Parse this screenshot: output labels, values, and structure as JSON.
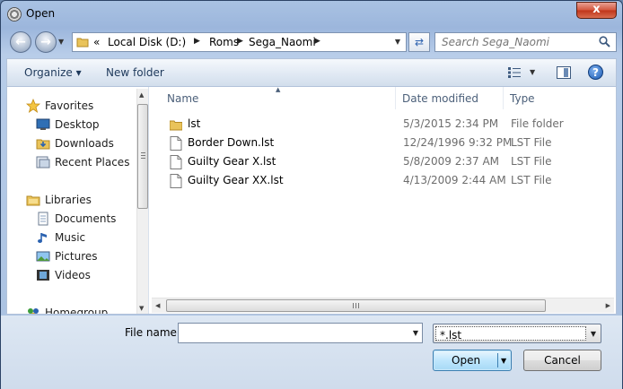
{
  "window": {
    "title": "Open",
    "close_label": "x"
  },
  "nav": {
    "back_label": "←",
    "forward_label": "→",
    "address_prefix": "«",
    "breadcrumb": [
      "Local Disk (D:)",
      "Roms",
      "Sega_Naomi"
    ],
    "refresh_label": "⇄",
    "search_placeholder": "Search Sega_Naomi"
  },
  "toolbar": {
    "organize_label": "Organize ▾",
    "new_folder_label": "New folder",
    "help_label": "?"
  },
  "sidebar": {
    "items": [
      {
        "label": "Favorites",
        "icon": "star-icon"
      },
      {
        "label": "Desktop",
        "icon": "desktop-icon"
      },
      {
        "label": "Downloads",
        "icon": "downloads-icon"
      },
      {
        "label": "Recent Places",
        "icon": "recent-places-icon"
      },
      {
        "label": "Libraries",
        "icon": "libraries-icon"
      },
      {
        "label": "Documents",
        "icon": "documents-icon"
      },
      {
        "label": "Music",
        "icon": "music-icon"
      },
      {
        "label": "Pictures",
        "icon": "pictures-icon"
      },
      {
        "label": "Videos",
        "icon": "videos-icon"
      },
      {
        "label": "Homegroup",
        "icon": "homegroup-icon"
      }
    ]
  },
  "files": {
    "columns": [
      "Name",
      "Date modified",
      "Type"
    ],
    "rows": [
      {
        "name": "lst",
        "date": "5/3/2015 2:34 PM",
        "type": "File folder",
        "icon": "folder-icon"
      },
      {
        "name": "Border Down.lst",
        "date": "12/24/1996 9:32 PM",
        "type": "LST File",
        "icon": "file-icon"
      },
      {
        "name": "Guilty Gear X.lst",
        "date": "5/8/2009 2:37 AM",
        "type": "LST File",
        "icon": "file-icon"
      },
      {
        "name": "Guilty Gear XX.lst",
        "date": "4/13/2009 2:44 AM",
        "type": "LST File",
        "icon": "file-icon"
      }
    ]
  },
  "footer": {
    "file_name_label": "File name:",
    "file_name_value": "",
    "filter_value": "*.lst",
    "open_label": "Open",
    "cancel_label": "Cancel"
  },
  "colors": {
    "title_bar": "#a9c2e3",
    "accent": "#3c7fb1",
    "close": "#c03419"
  }
}
